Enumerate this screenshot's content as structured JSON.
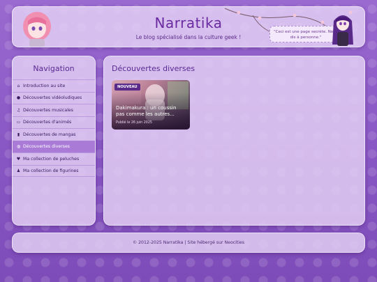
{
  "header": {
    "title": "Narratika",
    "subtitle": "Le blog spécialisé dans la culture geek !",
    "speech": "\"Ceci est une page secrète. Ne le dis à personne.\""
  },
  "sidebar": {
    "title": "Navigation",
    "items": [
      {
        "label": "Introduction au site",
        "icon": "home-icon",
        "active": false
      },
      {
        "label": "Découvertes vidéoludiques",
        "icon": "gamepad-icon",
        "active": false
      },
      {
        "label": "Découvertes musicales",
        "icon": "music-icon",
        "active": false
      },
      {
        "label": "Découvertes d'animés",
        "icon": "tv-icon",
        "active": false
      },
      {
        "label": "Découvertes de mangas",
        "icon": "book-icon",
        "active": false
      },
      {
        "label": "Découvertes diverses",
        "icon": "globe-icon",
        "active": true
      },
      {
        "label": "Ma collection de peluches",
        "icon": "heart-icon",
        "active": false
      },
      {
        "label": "Ma collection de figurines",
        "icon": "figures-icon",
        "active": false
      }
    ]
  },
  "main": {
    "title": "Découvertes diverses",
    "cards": [
      {
        "badge": "NOUVEAU",
        "title": "Dakimakura : un coussin pas comme les autres...",
        "date": "Publié le 26 juin 2025"
      }
    ]
  },
  "footer": {
    "copyright": "© 2012-2025 Narratika",
    "separator": " | ",
    "hosted": "Site hébergé sur Neocities"
  },
  "colors": {
    "accent": "#6a2aa0",
    "active_nav": "#a97ad6",
    "badge": "#5a2a8a"
  }
}
